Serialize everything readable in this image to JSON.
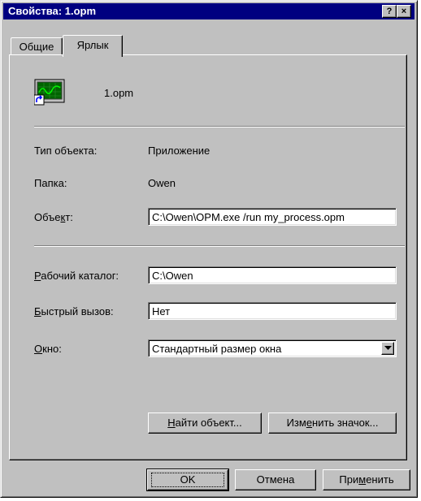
{
  "window": {
    "title": "Свойства: 1.opm",
    "help_button": "?",
    "close_button": "×"
  },
  "tabs": [
    {
      "label": "Общие",
      "active": false
    },
    {
      "label": "Ярлык",
      "active": true
    }
  ],
  "shortcut": {
    "file_name": "1.opm",
    "icon": "monitor-waveform-icon"
  },
  "fields": {
    "type_label": "Тип объекта:",
    "type_value": "Приложение",
    "folder_label": "Папка:",
    "folder_value": "Owen",
    "target_label_pre": "Объе",
    "target_label_acc": "к",
    "target_label_post": "т:",
    "target_value": "C:\\Owen\\OPM.exe /run my_process.opm",
    "workdir_label_acc": "Р",
    "workdir_label_post": "абочий каталог:",
    "workdir_value": "C:\\Owen",
    "hotkey_label_acc": "Б",
    "hotkey_label_post": "ыстрый вызов:",
    "hotkey_value": "Нет",
    "window_label_acc": "О",
    "window_label_post": "кно:",
    "window_value": "Стандартный размер окна"
  },
  "buttons": {
    "find_target_acc": "Н",
    "find_target_post": "айти объект...",
    "change_icon_pre": "Изм",
    "change_icon_acc": "е",
    "change_icon_post": "нить значок...",
    "ok": "OK",
    "cancel": "Отмена",
    "apply_pre": "При",
    "apply_acc": "м",
    "apply_post": "енить"
  },
  "colors": {
    "titlebar": "#000080",
    "face": "#c0c0c0",
    "icon_screen": "#006400",
    "icon_wave": "#00ff00"
  }
}
